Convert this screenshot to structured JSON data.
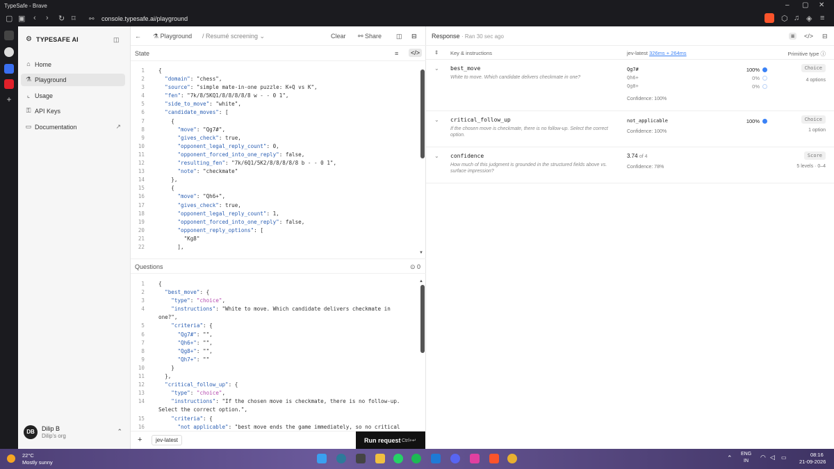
{
  "browser": {
    "window_title": "TypeSafe - Brave",
    "url": "console.typesafe.ai/playground"
  },
  "sidebar": {
    "brand": "TYPESAFE AI",
    "items": [
      {
        "label": "Home",
        "icon": "home-icon"
      },
      {
        "label": "Playground",
        "icon": "flask-icon"
      },
      {
        "label": "Usage",
        "icon": "chart-icon"
      },
      {
        "label": "API Keys",
        "icon": "key-icon"
      },
      {
        "label": "Documentation",
        "icon": "book-icon"
      }
    ],
    "user": {
      "initials": "DB",
      "name": "Dilip B",
      "org": "Dilip's org"
    }
  },
  "editor": {
    "breadcrumb_root": "Playground",
    "breadcrumb_current": "/ Resumé screening",
    "clear_label": "Clear",
    "share_label": "Share",
    "state_label": "State",
    "questions_label": "Questions",
    "questions_count": "0",
    "model": "jev-latest",
    "run_label": "Run request",
    "run_shortcut": "Ctrl+↵",
    "state_lines": [
      {
        "n": "1",
        "t": "{"
      },
      {
        "n": "2",
        "t": "  \"domain\": \"chess\","
      },
      {
        "n": "3",
        "t": "  \"source\": \"simple mate-in-one puzzle: K+Q vs K\","
      },
      {
        "n": "4",
        "t": "  \"fen\": \"7k/8/5KQ1/8/8/8/8/8 w - - 0 1\","
      },
      {
        "n": "5",
        "t": "  \"side_to_move\": \"white\","
      },
      {
        "n": "6",
        "t": "  \"candidate_moves\": ["
      },
      {
        "n": "7",
        "t": "    {"
      },
      {
        "n": "8",
        "t": "      \"move\": \"Qg7#\","
      },
      {
        "n": "9",
        "t": "      \"gives_check\": true,"
      },
      {
        "n": "10",
        "t": "      \"opponent_legal_reply_count\": 0,"
      },
      {
        "n": "11",
        "t": "      \"opponent_forced_into_one_reply\": false,"
      },
      {
        "n": "12",
        "t": "      \"resulting_fen\": \"7k/6Q1/5K2/8/8/8/8/8 b - - 0 1\","
      },
      {
        "n": "13",
        "t": "      \"note\": \"checkmate\""
      },
      {
        "n": "14",
        "t": "    },"
      },
      {
        "n": "15",
        "t": "    {"
      },
      {
        "n": "16",
        "t": "      \"move\": \"Qh6+\","
      },
      {
        "n": "17",
        "t": "      \"gives_check\": true,"
      },
      {
        "n": "18",
        "t": "      \"opponent_legal_reply_count\": 1,"
      },
      {
        "n": "19",
        "t": "      \"opponent_forced_into_one_reply\": false,"
      },
      {
        "n": "20",
        "t": "      \"opponent_reply_options\": ["
      },
      {
        "n": "21",
        "t": "        \"Kg8\""
      },
      {
        "n": "22",
        "t": "      ],"
      }
    ],
    "question_lines": [
      {
        "n": "1",
        "t": "{"
      },
      {
        "n": "2",
        "t": "  \"best_move\": {"
      },
      {
        "n": "3",
        "t": "    \"type\": \"choice\","
      },
      {
        "n": "4",
        "t": "    \"instructions\": \"White to move. Which candidate delivers checkmate in"
      },
      {
        "n": "",
        "t": "one?\","
      },
      {
        "n": "5",
        "t": "    \"criteria\": {"
      },
      {
        "n": "6",
        "t": "      \"Qg7#\": \"\","
      },
      {
        "n": "7",
        "t": "      \"Qh6+\": \"\","
      },
      {
        "n": "8",
        "t": "      \"Qg8+\": \"\","
      },
      {
        "n": "9",
        "t": "      \"Qh7+\": \"\""
      },
      {
        "n": "10",
        "t": "    }"
      },
      {
        "n": "11",
        "t": "  },"
      },
      {
        "n": "12",
        "t": "  \"critical_follow_up\": {"
      },
      {
        "n": "13",
        "t": "    \"type\": \"choice\","
      },
      {
        "n": "14",
        "t": "    \"instructions\": \"If the chosen move is checkmate, there is no follow-up."
      },
      {
        "n": "",
        "t": "Select the correct option.\","
      },
      {
        "n": "15",
        "t": "    \"criteria\": {"
      },
      {
        "n": "16",
        "t": "      \"not applicable\": \"best move ends the game immediately, so no critical"
      }
    ]
  },
  "response": {
    "title": "Response",
    "ran": "· Ran 30 sec ago",
    "col_key": "Key & instructions",
    "col_model": "jev-latest",
    "col_timing": "326ms + 264ms",
    "col_type": "Primitive type",
    "rows": [
      {
        "key": "best_move",
        "desc": "White to move. Which candidate delivers checkmate in one?",
        "options": [
          {
            "label": "Qg7#",
            "pct": "100%"
          },
          {
            "label": "Qh6+",
            "pct": "0%"
          },
          {
            "label": "Qg8+",
            "pct": "0%"
          }
        ],
        "confidence": "Confidence: 100%",
        "badge": "Choice",
        "meta": "4 options"
      },
      {
        "key": "critical_follow_up",
        "desc": "If the chosen move is checkmate, there is no follow-up. Select the correct option.",
        "options": [
          {
            "label": "not_applicable",
            "pct": "100%"
          }
        ],
        "confidence": "Confidence: 100%",
        "badge": "Choice",
        "meta": "1 option"
      },
      {
        "key": "confidence",
        "desc": "How much of this judgment is grounded in the structured fields above vs. surface impression?",
        "score": "3.74",
        "score_of": "of 4",
        "confidence": "Confidence: 78%",
        "badge": "Score",
        "meta": "5 levels · 0–4"
      }
    ]
  },
  "taskbar": {
    "temp": "22°C",
    "weather": "Mostly sunny",
    "lang": "ENG",
    "region": "IN",
    "time": "08:16",
    "date": "21-09-2026"
  },
  "colors": {
    "accent_blue": "#3b82f6",
    "brave_orange": "#fb542b",
    "run_button": "#111111"
  }
}
